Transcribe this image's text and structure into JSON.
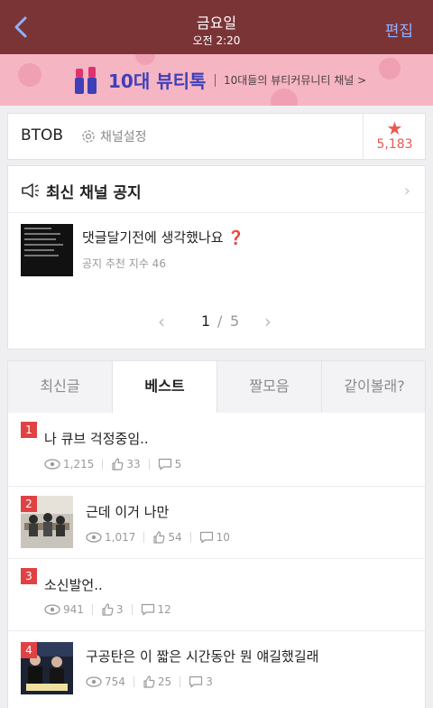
{
  "header": {
    "title": "금요일",
    "time": "오전 2:20",
    "edit_label": "편집"
  },
  "banner": {
    "name": "10대 뷰티톡",
    "subtitle": "10대들의 뷰티커뮤니티 채널 >"
  },
  "channel": {
    "name": "BTOB",
    "settings_label": "채널설정",
    "star_count": "5,183"
  },
  "notice": {
    "heading": "최신 채널 공지",
    "post_title": "댓글달기전에 생각했나요",
    "post_meta": "공지 추천 지수 46",
    "page_current": "1",
    "page_separator": "/",
    "page_total": "5"
  },
  "tabs": [
    {
      "label": "최신글",
      "active": false
    },
    {
      "label": "베스트",
      "active": true
    },
    {
      "label": "짤모음",
      "active": false
    },
    {
      "label": "같이볼래?",
      "active": false
    }
  ],
  "posts": [
    {
      "rank": "1",
      "title": "나 큐브 걱정중임..",
      "views": "1,215",
      "likes": "33",
      "comments": "5",
      "has_thumb": false
    },
    {
      "rank": "2",
      "title": "근데 이거 나만",
      "views": "1,017",
      "likes": "54",
      "comments": "10",
      "has_thumb": true
    },
    {
      "rank": "3",
      "title": "소신발언..",
      "views": "941",
      "likes": "3",
      "comments": "12",
      "has_thumb": false
    },
    {
      "rank": "4",
      "title": "구공탄은 이 짧은 시간동안 뭔 얘길했길래",
      "views": "754",
      "likes": "25",
      "comments": "3",
      "has_thumb": true
    }
  ],
  "colors": {
    "header_bg": "#7b3436",
    "accent_blue": "#8fb0ff",
    "rank_red": "#e04244",
    "star_red": "#e85a4f",
    "banner_pink": "#f6b5c3"
  }
}
